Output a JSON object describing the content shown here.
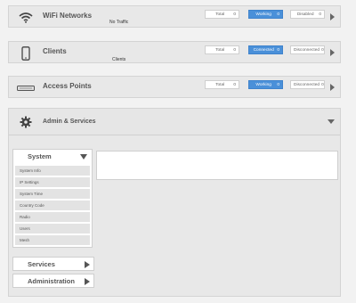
{
  "wifi": {
    "title": "WiFi Networks",
    "sub": "No Traffic",
    "pills": [
      {
        "label": "Total",
        "value": "0"
      },
      {
        "label": "Working",
        "value": "0"
      },
      {
        "label": "Disabled",
        "value": "0"
      }
    ]
  },
  "clients": {
    "title": "Clients",
    "sub": "Clients",
    "pills": [
      {
        "label": "Total",
        "value": "0"
      },
      {
        "label": "Connected",
        "value": "0"
      },
      {
        "label": "Disconnected",
        "value": "0"
      }
    ]
  },
  "access_points": {
    "title": "Access Points",
    "pills": [
      {
        "label": "Total",
        "value": "0"
      },
      {
        "label": "Working",
        "value": "0"
      },
      {
        "label": "Disconnected",
        "value": "0"
      }
    ]
  },
  "admin": {
    "title": "Admin & Services",
    "system": {
      "label": "System",
      "items": [
        "System Info",
        "IP Settings",
        "System Time",
        "Country Code",
        "Radio",
        "Users",
        "Mesh"
      ]
    },
    "services_label": "Services",
    "administration_label": "Administration"
  },
  "colors": {
    "accent": "#4a90d9",
    "panel": "#e8e8e8",
    "background": "#f2f2f2"
  }
}
